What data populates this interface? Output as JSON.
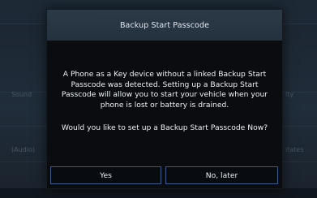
{
  "dialog": {
    "title": "Backup Start Passcode",
    "message": "A Phone as a Key device without a linked Backup Start Passcode was detected. Setting up a Backup Start Passcode will allow you to start your vehicle when your phone is lost or battery is drained.",
    "question": "Would you like to set up a Backup Start Passcode Now?",
    "buttons": {
      "yes_label": "Yes",
      "no_label": "No, later"
    }
  },
  "background": {
    "left_labels": [
      "Sound",
      "(Audio)"
    ],
    "right_labels": [
      "ity",
      "itates"
    ]
  },
  "colors": {
    "dialog_background": "#0a0c0f",
    "header_background": "#2c3a48",
    "button_border": "#3a5a88",
    "text": "#eef2f5"
  }
}
